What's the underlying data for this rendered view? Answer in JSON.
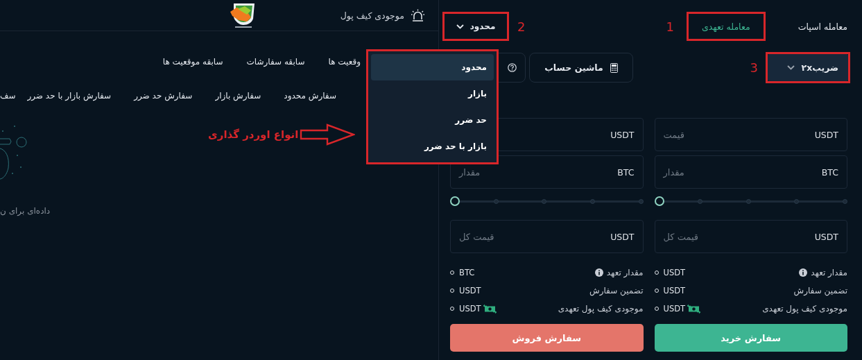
{
  "header": {
    "wallet_label": "موجودی کیف پول"
  },
  "position_tabs": [
    {
      "label": "وقعیت ها"
    },
    {
      "label": "سابقه سفارشات"
    },
    {
      "label": "سابقه موقعیت ها"
    }
  ],
  "order_type_tabs": [
    {
      "label": "سفارش محدود"
    },
    {
      "label": "سفارش بازار"
    },
    {
      "label": "سفارش حد ضرر"
    },
    {
      "label": "سفارش بازار با حد ضرر"
    },
    {
      "label": "سف"
    }
  ],
  "empty_state": {
    "text": "داده‌ای برای ن"
  },
  "trade_panel": {
    "mode_tabs": [
      {
        "label": "معامله اسپات",
        "selected": false
      },
      {
        "label": "معامله تعهدی",
        "selected": true
      }
    ],
    "order_type_select": {
      "value": "محدود"
    },
    "leverage_select": {
      "value": "ضریب۲x"
    },
    "calculator_button": {
      "label": "ماشین حساب"
    },
    "columns": [
      {
        "kind": "buy",
        "fields": [
          {
            "placeholder": "قیمت",
            "unit": "USDT"
          },
          {
            "placeholder": "مقدار",
            "unit": "BTC"
          }
        ],
        "slider": {
          "level": 0
        },
        "total_field": {
          "placeholder": "قیمت کل",
          "unit": "USDT"
        },
        "info_rows": [
          {
            "kind": "info",
            "label": "مقدار تعهد",
            "value": "USDT"
          },
          {
            "kind": "plain",
            "label": "تضمین سفارش",
            "value": "USDT"
          },
          {
            "kind": "wallet",
            "label": "موجودی کیف پول تعهدی",
            "value": "USDT"
          }
        ],
        "submit": {
          "label": "سفارش خرید"
        }
      },
      {
        "kind": "sell",
        "fields": [
          {
            "unit": "USDT"
          },
          {
            "placeholder": "مقدار",
            "unit": "BTC"
          }
        ],
        "slider": {
          "level": 0
        },
        "total_field": {
          "placeholder": "قیمت کل",
          "unit": "USDT"
        },
        "info_rows": [
          {
            "kind": "info",
            "label": "مقدار تعهد",
            "value": "BTC"
          },
          {
            "kind": "plain",
            "label": "تضمین سفارش",
            "value": "USDT"
          },
          {
            "kind": "wallet",
            "label": "موجودی کیف پول تعهدی",
            "value": "USDT"
          }
        ],
        "submit": {
          "label": "سفارش فروش"
        }
      }
    ]
  },
  "order_type_menu": {
    "items": [
      {
        "label": "محدود",
        "selected": true
      },
      {
        "label": "بازار",
        "selected": false
      },
      {
        "label": "حد ضرر",
        "selected": false
      },
      {
        "label": "بازار با حد ضرر",
        "selected": false
      }
    ]
  },
  "annotations": {
    "markers": [
      "1",
      "2",
      "3"
    ],
    "arrow_label": "انواع اوردر گذاری"
  }
}
